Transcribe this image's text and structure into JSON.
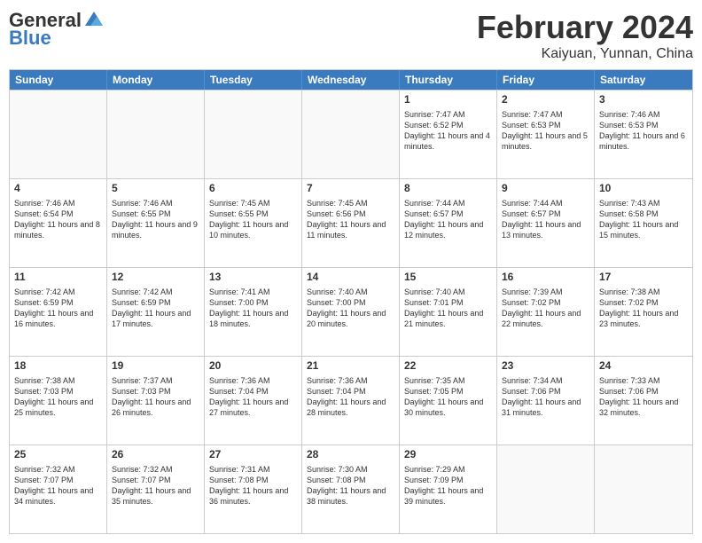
{
  "logo": {
    "general": "General",
    "blue": "Blue"
  },
  "title": {
    "month_year": "February 2024",
    "location": "Kaiyuan, Yunnan, China"
  },
  "weekdays": [
    "Sunday",
    "Monday",
    "Tuesday",
    "Wednesday",
    "Thursday",
    "Friday",
    "Saturday"
  ],
  "rows": [
    [
      {
        "day": "",
        "info": ""
      },
      {
        "day": "",
        "info": ""
      },
      {
        "day": "",
        "info": ""
      },
      {
        "day": "",
        "info": ""
      },
      {
        "day": "1",
        "info": "Sunrise: 7:47 AM\nSunset: 6:52 PM\nDaylight: 11 hours and 4 minutes."
      },
      {
        "day": "2",
        "info": "Sunrise: 7:47 AM\nSunset: 6:53 PM\nDaylight: 11 hours and 5 minutes."
      },
      {
        "day": "3",
        "info": "Sunrise: 7:46 AM\nSunset: 6:53 PM\nDaylight: 11 hours and 6 minutes."
      }
    ],
    [
      {
        "day": "4",
        "info": "Sunrise: 7:46 AM\nSunset: 6:54 PM\nDaylight: 11 hours and 8 minutes."
      },
      {
        "day": "5",
        "info": "Sunrise: 7:46 AM\nSunset: 6:55 PM\nDaylight: 11 hours and 9 minutes."
      },
      {
        "day": "6",
        "info": "Sunrise: 7:45 AM\nSunset: 6:55 PM\nDaylight: 11 hours and 10 minutes."
      },
      {
        "day": "7",
        "info": "Sunrise: 7:45 AM\nSunset: 6:56 PM\nDaylight: 11 hours and 11 minutes."
      },
      {
        "day": "8",
        "info": "Sunrise: 7:44 AM\nSunset: 6:57 PM\nDaylight: 11 hours and 12 minutes."
      },
      {
        "day": "9",
        "info": "Sunrise: 7:44 AM\nSunset: 6:57 PM\nDaylight: 11 hours and 13 minutes."
      },
      {
        "day": "10",
        "info": "Sunrise: 7:43 AM\nSunset: 6:58 PM\nDaylight: 11 hours and 15 minutes."
      }
    ],
    [
      {
        "day": "11",
        "info": "Sunrise: 7:42 AM\nSunset: 6:59 PM\nDaylight: 11 hours and 16 minutes."
      },
      {
        "day": "12",
        "info": "Sunrise: 7:42 AM\nSunset: 6:59 PM\nDaylight: 11 hours and 17 minutes."
      },
      {
        "day": "13",
        "info": "Sunrise: 7:41 AM\nSunset: 7:00 PM\nDaylight: 11 hours and 18 minutes."
      },
      {
        "day": "14",
        "info": "Sunrise: 7:40 AM\nSunset: 7:00 PM\nDaylight: 11 hours and 20 minutes."
      },
      {
        "day": "15",
        "info": "Sunrise: 7:40 AM\nSunset: 7:01 PM\nDaylight: 11 hours and 21 minutes."
      },
      {
        "day": "16",
        "info": "Sunrise: 7:39 AM\nSunset: 7:02 PM\nDaylight: 11 hours and 22 minutes."
      },
      {
        "day": "17",
        "info": "Sunrise: 7:38 AM\nSunset: 7:02 PM\nDaylight: 11 hours and 23 minutes."
      }
    ],
    [
      {
        "day": "18",
        "info": "Sunrise: 7:38 AM\nSunset: 7:03 PM\nDaylight: 11 hours and 25 minutes."
      },
      {
        "day": "19",
        "info": "Sunrise: 7:37 AM\nSunset: 7:03 PM\nDaylight: 11 hours and 26 minutes."
      },
      {
        "day": "20",
        "info": "Sunrise: 7:36 AM\nSunset: 7:04 PM\nDaylight: 11 hours and 27 minutes."
      },
      {
        "day": "21",
        "info": "Sunrise: 7:36 AM\nSunset: 7:04 PM\nDaylight: 11 hours and 28 minutes."
      },
      {
        "day": "22",
        "info": "Sunrise: 7:35 AM\nSunset: 7:05 PM\nDaylight: 11 hours and 30 minutes."
      },
      {
        "day": "23",
        "info": "Sunrise: 7:34 AM\nSunset: 7:06 PM\nDaylight: 11 hours and 31 minutes."
      },
      {
        "day": "24",
        "info": "Sunrise: 7:33 AM\nSunset: 7:06 PM\nDaylight: 11 hours and 32 minutes."
      }
    ],
    [
      {
        "day": "25",
        "info": "Sunrise: 7:32 AM\nSunset: 7:07 PM\nDaylight: 11 hours and 34 minutes."
      },
      {
        "day": "26",
        "info": "Sunrise: 7:32 AM\nSunset: 7:07 PM\nDaylight: 11 hours and 35 minutes."
      },
      {
        "day": "27",
        "info": "Sunrise: 7:31 AM\nSunset: 7:08 PM\nDaylight: 11 hours and 36 minutes."
      },
      {
        "day": "28",
        "info": "Sunrise: 7:30 AM\nSunset: 7:08 PM\nDaylight: 11 hours and 38 minutes."
      },
      {
        "day": "29",
        "info": "Sunrise: 7:29 AM\nSunset: 7:09 PM\nDaylight: 11 hours and 39 minutes."
      },
      {
        "day": "",
        "info": ""
      },
      {
        "day": "",
        "info": ""
      }
    ]
  ]
}
